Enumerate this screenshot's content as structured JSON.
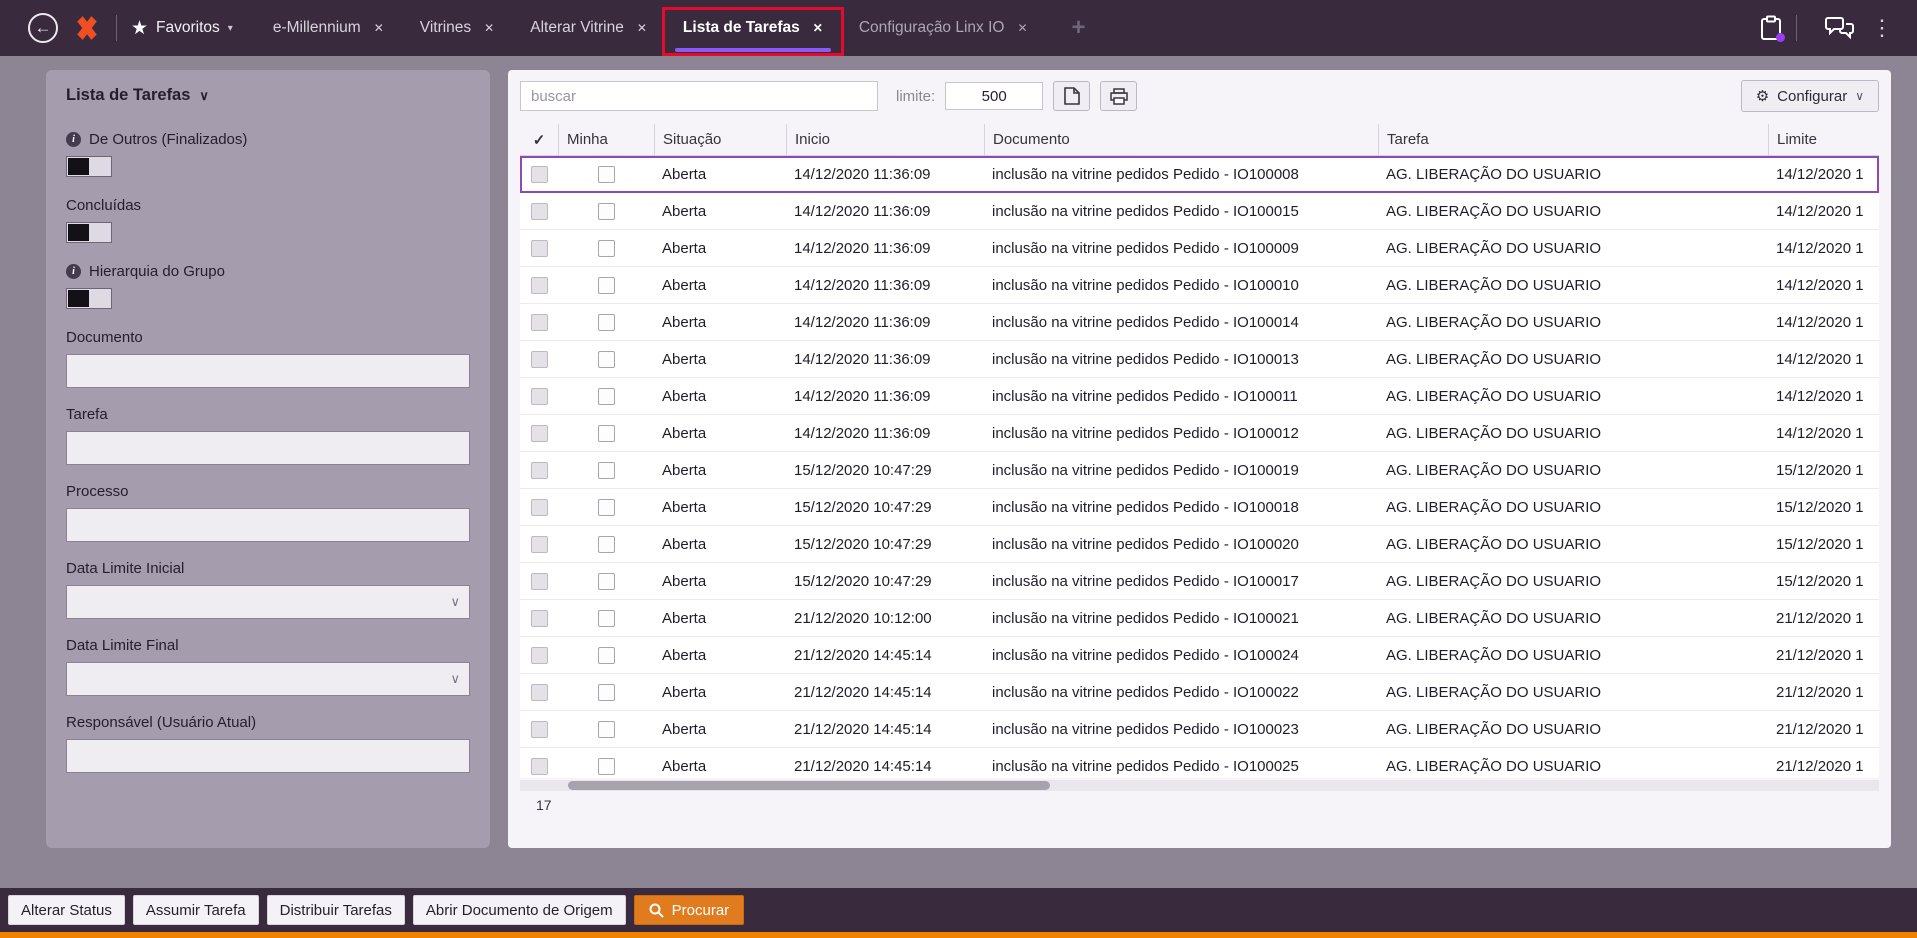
{
  "icons": {
    "back": "←",
    "star": "★",
    "caret_down": "▾",
    "close": "✕",
    "plus": "+",
    "dots": "⋮",
    "chevron_down": "∨",
    "info": "i",
    "gear": "⚙"
  },
  "colors": {
    "topbar": "#3a2a3e",
    "accent_purple": "#8a5cf7",
    "annotation_red": "#e50b2c",
    "procurar_orange": "#e07c1e",
    "bottom_strip_orange": "#f08200"
  },
  "topbar": {
    "favorites_label": "Favoritos",
    "tabs": [
      {
        "label": "e-Millennium",
        "active": false,
        "annotated": false,
        "muted": false
      },
      {
        "label": "Vitrines",
        "active": false,
        "annotated": false,
        "muted": false
      },
      {
        "label": "Alterar Vitrine",
        "active": false,
        "annotated": false,
        "muted": false
      },
      {
        "label": "Lista de Tarefas",
        "active": true,
        "annotated": true,
        "muted": false
      },
      {
        "label": "Configuração Linx IO",
        "active": false,
        "annotated": false,
        "muted": true
      }
    ]
  },
  "sidebar": {
    "title": "Lista de Tarefas",
    "toggles": [
      {
        "label": "De Outros (Finalizados)",
        "info": true,
        "on": false
      },
      {
        "label": "Concluídas",
        "info": false,
        "on": false
      },
      {
        "label": "Hierarquia do Grupo",
        "info": true,
        "on": false
      }
    ],
    "fields": [
      {
        "label": "Documento",
        "type": "text",
        "value": ""
      },
      {
        "label": "Tarefa",
        "type": "text",
        "value": ""
      },
      {
        "label": "Processo",
        "type": "text",
        "value": ""
      },
      {
        "label": "Data Limite Inicial",
        "type": "select",
        "value": ""
      },
      {
        "label": "Data Limite Final",
        "type": "select",
        "value": ""
      },
      {
        "label": "Responsável (Usuário Atual)",
        "type": "text",
        "value": ""
      }
    ]
  },
  "toolbar": {
    "search_placeholder": "buscar",
    "limit_label": "limite:",
    "limit_value": "500",
    "configure_label": "Configurar"
  },
  "table": {
    "columns": [
      "✓",
      "Minha",
      "Situação",
      "Inicio",
      "Documento",
      "Tarefa",
      "Limite"
    ],
    "count": "17",
    "rows": [
      {
        "selected": true,
        "minha": false,
        "situacao": "Aberta",
        "inicio": "14/12/2020 11:36:09",
        "documento": "inclusão na vitrine pedidos Pedido - IO100008",
        "tarefa": "AG. LIBERAÇÃO DO USUARIO",
        "limite": "14/12/2020 1"
      },
      {
        "selected": false,
        "minha": false,
        "situacao": "Aberta",
        "inicio": "14/12/2020 11:36:09",
        "documento": "inclusão na vitrine pedidos Pedido - IO100015",
        "tarefa": "AG. LIBERAÇÃO DO USUARIO",
        "limite": "14/12/2020 1"
      },
      {
        "selected": false,
        "minha": false,
        "situacao": "Aberta",
        "inicio": "14/12/2020 11:36:09",
        "documento": "inclusão na vitrine pedidos Pedido - IO100009",
        "tarefa": "AG. LIBERAÇÃO DO USUARIO",
        "limite": "14/12/2020 1"
      },
      {
        "selected": false,
        "minha": false,
        "situacao": "Aberta",
        "inicio": "14/12/2020 11:36:09",
        "documento": "inclusão na vitrine pedidos Pedido - IO100010",
        "tarefa": "AG. LIBERAÇÃO DO USUARIO",
        "limite": "14/12/2020 1"
      },
      {
        "selected": false,
        "minha": false,
        "situacao": "Aberta",
        "inicio": "14/12/2020 11:36:09",
        "documento": "inclusão na vitrine pedidos Pedido - IO100014",
        "tarefa": "AG. LIBERAÇÃO DO USUARIO",
        "limite": "14/12/2020 1"
      },
      {
        "selected": false,
        "minha": false,
        "situacao": "Aberta",
        "inicio": "14/12/2020 11:36:09",
        "documento": "inclusão na vitrine pedidos Pedido - IO100013",
        "tarefa": "AG. LIBERAÇÃO DO USUARIO",
        "limite": "14/12/2020 1"
      },
      {
        "selected": false,
        "minha": false,
        "situacao": "Aberta",
        "inicio": "14/12/2020 11:36:09",
        "documento": "inclusão na vitrine pedidos Pedido - IO100011",
        "tarefa": "AG. LIBERAÇÃO DO USUARIO",
        "limite": "14/12/2020 1"
      },
      {
        "selected": false,
        "minha": false,
        "situacao": "Aberta",
        "inicio": "14/12/2020 11:36:09",
        "documento": "inclusão na vitrine pedidos Pedido - IO100012",
        "tarefa": "AG. LIBERAÇÃO DO USUARIO",
        "limite": "14/12/2020 1"
      },
      {
        "selected": false,
        "minha": false,
        "situacao": "Aberta",
        "inicio": "15/12/2020 10:47:29",
        "documento": "inclusão na vitrine pedidos Pedido - IO100019",
        "tarefa": "AG. LIBERAÇÃO DO USUARIO",
        "limite": "15/12/2020 1"
      },
      {
        "selected": false,
        "minha": false,
        "situacao": "Aberta",
        "inicio": "15/12/2020 10:47:29",
        "documento": "inclusão na vitrine pedidos Pedido - IO100018",
        "tarefa": "AG. LIBERAÇÃO DO USUARIO",
        "limite": "15/12/2020 1"
      },
      {
        "selected": false,
        "minha": false,
        "situacao": "Aberta",
        "inicio": "15/12/2020 10:47:29",
        "documento": "inclusão na vitrine pedidos Pedido - IO100020",
        "tarefa": "AG. LIBERAÇÃO DO USUARIO",
        "limite": "15/12/2020 1"
      },
      {
        "selected": false,
        "minha": false,
        "situacao": "Aberta",
        "inicio": "15/12/2020 10:47:29",
        "documento": "inclusão na vitrine pedidos Pedido - IO100017",
        "tarefa": "AG. LIBERAÇÃO DO USUARIO",
        "limite": "15/12/2020 1"
      },
      {
        "selected": false,
        "minha": false,
        "situacao": "Aberta",
        "inicio": "21/12/2020 10:12:00",
        "documento": "inclusão na vitrine pedidos Pedido - IO100021",
        "tarefa": "AG. LIBERAÇÃO DO USUARIO",
        "limite": "21/12/2020 1"
      },
      {
        "selected": false,
        "minha": false,
        "situacao": "Aberta",
        "inicio": "21/12/2020 14:45:14",
        "documento": "inclusão na vitrine pedidos Pedido - IO100024",
        "tarefa": "AG. LIBERAÇÃO DO USUARIO",
        "limite": "21/12/2020 1"
      },
      {
        "selected": false,
        "minha": false,
        "situacao": "Aberta",
        "inicio": "21/12/2020 14:45:14",
        "documento": "inclusão na vitrine pedidos Pedido - IO100022",
        "tarefa": "AG. LIBERAÇÃO DO USUARIO",
        "limite": "21/12/2020 1"
      },
      {
        "selected": false,
        "minha": false,
        "situacao": "Aberta",
        "inicio": "21/12/2020 14:45:14",
        "documento": "inclusão na vitrine pedidos Pedido - IO100023",
        "tarefa": "AG. LIBERAÇÃO DO USUARIO",
        "limite": "21/12/2020 1"
      },
      {
        "selected": false,
        "minha": false,
        "situacao": "Aberta",
        "inicio": "21/12/2020 14:45:14",
        "documento": "inclusão na vitrine pedidos Pedido - IO100025",
        "tarefa": "AG. LIBERAÇÃO DO USUARIO",
        "limite": "21/12/2020 1"
      }
    ]
  },
  "footer": {
    "buttons": [
      "Alterar Status",
      "Assumir Tarefa",
      "Distribuir Tarefas",
      "Abrir Documento de Origem"
    ],
    "search_label": "Procurar"
  }
}
